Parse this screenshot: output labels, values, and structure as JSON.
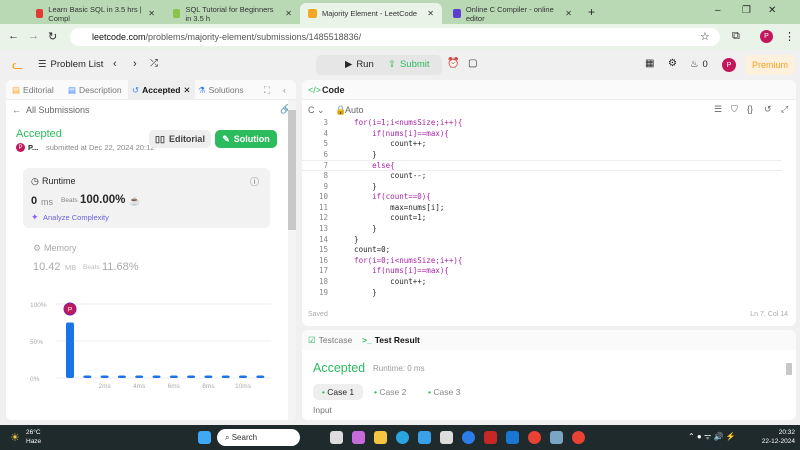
{
  "browser": {
    "tabs": [
      {
        "title": "Learn Basic SQL in 3.5 hrs | Compl",
        "color": "#e53935"
      },
      {
        "title": "SQL Tutorial for Beginners in 3.5 h",
        "color": "#8bc34a"
      },
      {
        "title": "Majority Element - LeetCode",
        "color": "#f5a623"
      },
      {
        "title": "Online C Compiler - online editor",
        "color": "#5c3fd1"
      }
    ],
    "url_domain": "leetcode.com",
    "url_path": "/problems/majority-element/submissions/1485518836/",
    "profile": "P"
  },
  "header": {
    "problem_list": "Problem List",
    "run": "Run",
    "submit": "Submit",
    "streak": "0",
    "avatar": "P",
    "premium": "Premium"
  },
  "left": {
    "tabs": [
      "Editorial",
      "Description",
      "Accepted",
      "Solutions"
    ],
    "back": "All Submissions",
    "status": "Accepted",
    "user": "P...",
    "submitted": "submitted at Dec 22, 2024 20:12",
    "editorial_btn": "Editorial",
    "solution_btn": "Solution",
    "runtime": {
      "label": "Runtime",
      "value": "0",
      "unit": "ms",
      "beats_label": "Beats",
      "beats": "100.00%",
      "analyze": "Analyze Complexity"
    },
    "memory": {
      "label": "Memory",
      "value": "10.42",
      "unit": "MB",
      "beats_label": "Beats",
      "beats": "11.68%"
    }
  },
  "chart_data": {
    "type": "bar",
    "categories": [
      "0ms",
      "1ms",
      "2ms",
      "3ms",
      "4ms",
      "5ms",
      "6ms",
      "7ms",
      "8ms",
      "9ms",
      "10ms",
      "11ms"
    ],
    "values": [
      75,
      1,
      1,
      3,
      1,
      1,
      1,
      1,
      1,
      1,
      1,
      1
    ],
    "y_ticks": [
      "100%",
      "50%",
      "0%"
    ],
    "x_ticks": [
      "2ms",
      "4ms",
      "6ms",
      "8ms",
      "10ms"
    ],
    "ylim": [
      0,
      100
    ],
    "marker": "P"
  },
  "code": {
    "title": "Code",
    "lang": "C",
    "mode": "Auto",
    "saved": "Saved",
    "cursor": "Ln 7, Col 14",
    "lines": [
      {
        "n": "3",
        "t": "    for(i=1;i<numsSize;i++){"
      },
      {
        "n": "4",
        "t": "        if(nums[i]==max){"
      },
      {
        "n": "5",
        "t": "            count++;"
      },
      {
        "n": "6",
        "t": "        }"
      },
      {
        "n": "7",
        "t": "        else{"
      },
      {
        "n": "8",
        "t": "            count--;"
      },
      {
        "n": "9",
        "t": "        }"
      },
      {
        "n": "10",
        "t": "        if(count==0){"
      },
      {
        "n": "11",
        "t": "            max=nums[i];"
      },
      {
        "n": "12",
        "t": "            count=1;"
      },
      {
        "n": "13",
        "t": "        }"
      },
      {
        "n": "14",
        "t": "    }"
      },
      {
        "n": "15",
        "t": "    count=0;"
      },
      {
        "n": "16",
        "t": "    for(i=0;i<numsSize;i++){"
      },
      {
        "n": "17",
        "t": "        if(nums[i]==max){"
      },
      {
        "n": "18",
        "t": "            count++;"
      },
      {
        "n": "19",
        "t": "        }"
      }
    ]
  },
  "result": {
    "testcase": "Testcase",
    "test_result": "Test Result",
    "status": "Accepted",
    "runtime": "Runtime: 0 ms",
    "cases": [
      "Case 1",
      "Case 2",
      "Case 3"
    ],
    "input": "Input"
  },
  "taskbar": {
    "temp": "26°C",
    "weather": "Haze",
    "search": "Search",
    "time": "20:32",
    "date": "22-12-2024"
  }
}
